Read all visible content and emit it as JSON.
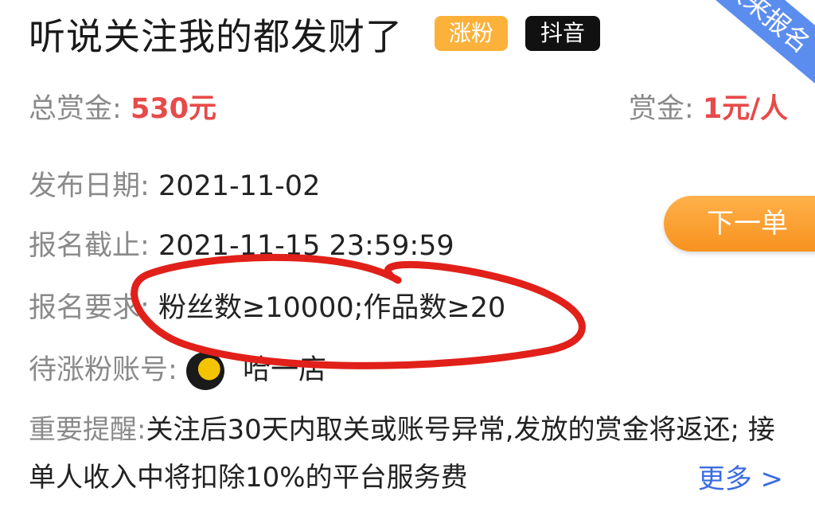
{
  "task": {
    "title": "听说关注我的都发财了",
    "tags": [
      "涨粉",
      "抖音"
    ],
    "corner_badge": "快来报名"
  },
  "reward": {
    "total_label": "总赏金:",
    "total_value": "530元",
    "per_label": "赏金:",
    "per_value": "1元/人"
  },
  "details": {
    "publish_label": "发布日期:",
    "publish_value": "2021-11-02",
    "deadline_label": "报名截止:",
    "deadline_value": "2021-11-15 23:59:59",
    "requirement_label": "报名要求:",
    "requirement_value": "粉丝数≥10000;作品数≥20",
    "account_label": "待涨粉账号:",
    "account_name": "哈一店"
  },
  "next_button": "下一单",
  "notice": {
    "label": "重要提醒:",
    "text": "关注后30天内取关或账号异常,发放的赏金将返还; 接单人收入中将扣除10%的平台服务费",
    "more": "更多 >"
  }
}
